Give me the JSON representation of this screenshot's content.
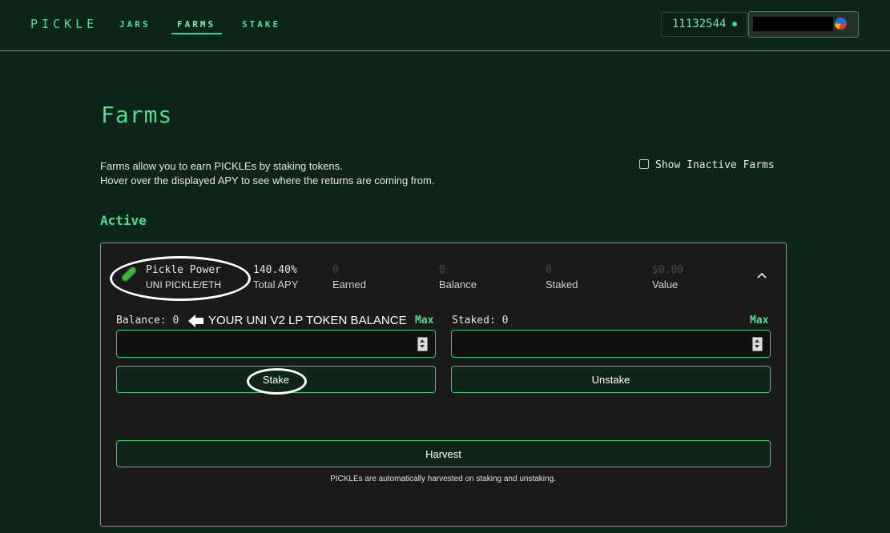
{
  "header": {
    "logo": "PICKLE",
    "nav": [
      {
        "label": "JARS",
        "active": false
      },
      {
        "label": "FARMS",
        "active": true
      },
      {
        "label": "STAKE",
        "active": false
      }
    ],
    "block_number": "11132544",
    "accent": "#4ee08c"
  },
  "page": {
    "title": "Farms",
    "description_line1": "Farms allow you to earn PICKLEs by staking tokens.",
    "description_line2": "Hover over the displayed APY to see where the returns are coming from.",
    "show_inactive_label": "Show Inactive Farms",
    "show_inactive_checked": false,
    "active_heading": "Active"
  },
  "farm": {
    "name": "Pickle Power",
    "pair": "UNI PICKLE/ETH",
    "stats": [
      {
        "value": "140.40%",
        "label": "Total APY"
      },
      {
        "value": "0",
        "label": "Earned"
      },
      {
        "value": "0",
        "label": "Balance"
      },
      {
        "value": "0",
        "label": "Staked"
      },
      {
        "value": "$0.00",
        "label": "Value"
      }
    ],
    "balance_label": "Balance: 0",
    "staked_label": "Staked: 0",
    "max_label": "Max",
    "stake_input_value": "",
    "unstake_input_value": "",
    "stake_button": "Stake",
    "unstake_button": "Unstake",
    "harvest_button": "Harvest",
    "harvest_note": "PICKLEs are automatically harvested on staking and unstaking."
  },
  "annotation": {
    "text": "YOUR UNI V2 LP TOKEN BALANCE"
  }
}
